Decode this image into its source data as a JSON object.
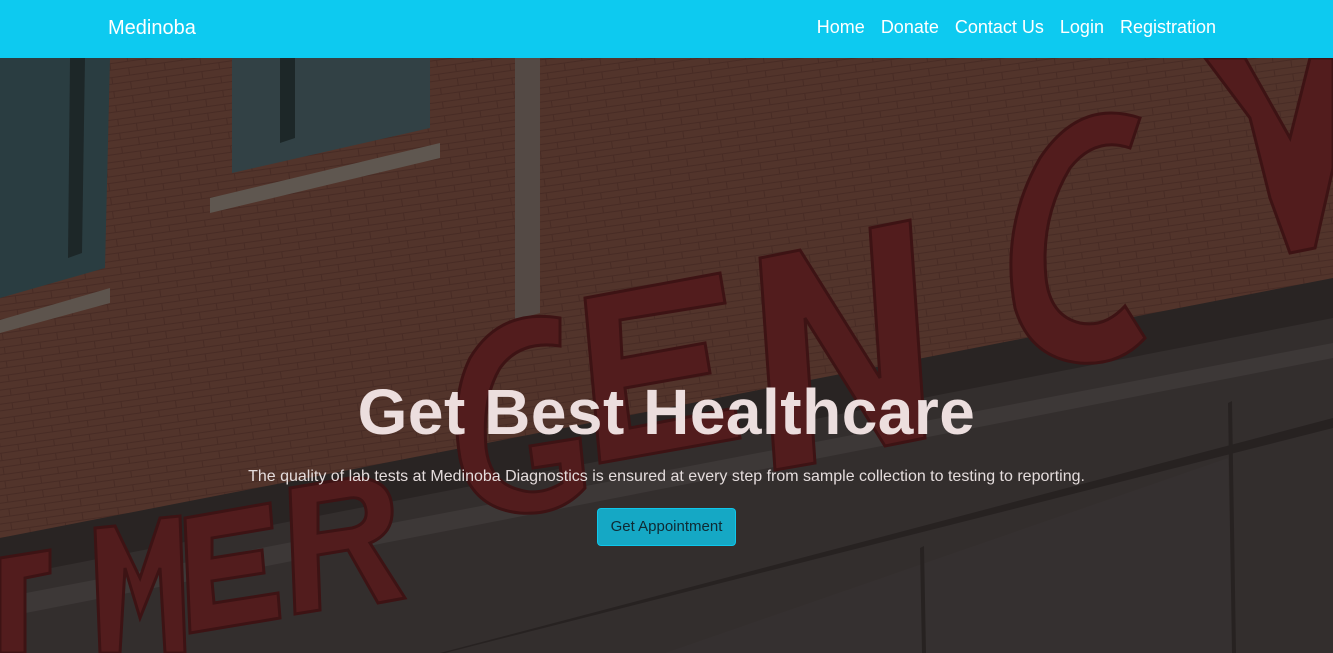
{
  "navbar": {
    "brand": "Medinoba",
    "links": [
      "Home",
      "Donate",
      "Contact Us",
      "Login",
      "Registration"
    ],
    "background_color": "#0dcaf0"
  },
  "hero": {
    "title": "Get Best Healthcare",
    "subtitle": "The quality of lab tests at Medinoba Diagnostics is ensured at every step from sample collection to testing to reporting.",
    "cta_label": "Get Appointment",
    "background_sign_text": "EMERGENCY"
  }
}
